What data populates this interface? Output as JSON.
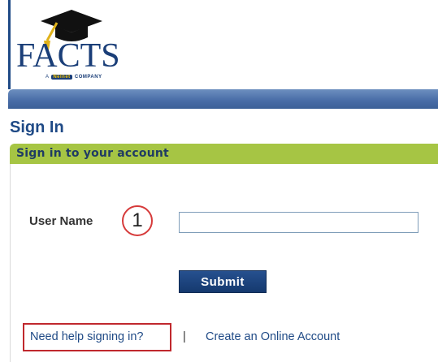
{
  "header": {
    "logo_text": "FACTS",
    "logo_tagline_prefix": "A",
    "logo_tagline_brand": "Nelnet",
    "logo_tagline_suffix": "COMPANY"
  },
  "page": {
    "title": "Sign In"
  },
  "panel": {
    "header": "Sign in to your account"
  },
  "form": {
    "username_label": "User Name",
    "step_number": "1",
    "username_value": "",
    "username_placeholder": "",
    "submit_label": "Submit"
  },
  "links": {
    "help": "Need help signing in?",
    "separator": "|",
    "create_account": "Create an Online Account"
  },
  "colors": {
    "brand_navy": "#1f4a86",
    "panel_green": "#a6c544",
    "highlight_red": "#c0282d",
    "button_navy": "#15396e"
  }
}
